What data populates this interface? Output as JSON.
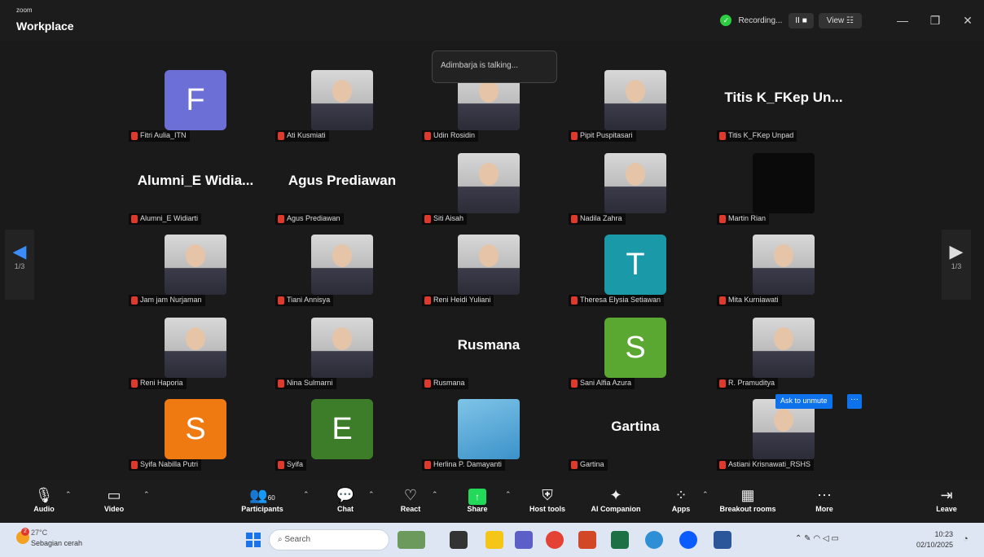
{
  "titlebar": {
    "brand_small": "zoom",
    "brand": "Workplace",
    "recording": "Recording...",
    "pause_stop": "II ■",
    "view": "View ☷",
    "minimize": "—",
    "restore": "❐",
    "close": "✕"
  },
  "talking_notice": "Adimbarja is talking...",
  "page_indicator": "1/3",
  "page_indicator_right": "1/3",
  "participants": [
    {
      "label": "Fitri Aulia_ITN",
      "avatar_letter": "F",
      "avatar_color": "#6b6fd6",
      "kind": "letter"
    },
    {
      "label": "Ati Kusmiati",
      "kind": "photo"
    },
    {
      "label": "Udin Rosidin",
      "kind": "photo"
    },
    {
      "label": "Pipit Puspitasari",
      "kind": "photo"
    },
    {
      "label": "Titis K_FKep Unpad",
      "display_name": "Titis K_FKep Un...",
      "kind": "name"
    },
    {
      "label": "Alumni_E Widiarti",
      "display_name": "Alumni_E Widia...",
      "kind": "name"
    },
    {
      "label": "Agus Prediawan",
      "display_name": "Agus Prediawan",
      "kind": "name"
    },
    {
      "label": "Siti Aisah",
      "kind": "photo"
    },
    {
      "label": "Nadila Zahra",
      "kind": "photo"
    },
    {
      "label": "Martin Rian",
      "kind": "dark"
    },
    {
      "label": "Jam jam Nurjaman",
      "kind": "photo"
    },
    {
      "label": "Tiani Annisya",
      "kind": "photo"
    },
    {
      "label": "Reni Heidi Yuliani",
      "kind": "photo"
    },
    {
      "label": "Theresa Elysia Setiawan",
      "avatar_letter": "T",
      "avatar_color": "#1a9aa8",
      "kind": "letter"
    },
    {
      "label": "Mita Kurniawati",
      "kind": "photo"
    },
    {
      "label": "Reni Haporia",
      "kind": "photo"
    },
    {
      "label": "Nina Sulmarni",
      "kind": "photo"
    },
    {
      "label": "Rusmana",
      "display_name": "Rusmana",
      "kind": "name"
    },
    {
      "label": "Sani Alfia Azura",
      "avatar_letter": "S",
      "avatar_color": "#5aa832",
      "kind": "letter"
    },
    {
      "label": "R. Pramuditya",
      "kind": "photo"
    },
    {
      "label": "Syifa Nabilla Putri",
      "avatar_letter": "S",
      "avatar_color": "#f07a12",
      "kind": "letter"
    },
    {
      "label": "Syifa",
      "avatar_letter": "E",
      "avatar_color": "#3d7d2a",
      "kind": "letter"
    },
    {
      "label": "Herlina P. Damayanti",
      "kind": "flower"
    },
    {
      "label": "Gartina",
      "display_name": "Gartina",
      "kind": "name"
    },
    {
      "label": "Astiani Krisnawati_RSHS",
      "kind": "photo"
    }
  ],
  "ask_unmute": "Ask to unmute",
  "ask_more": "···",
  "toolbar": {
    "audio": "Audio",
    "video": "Video",
    "participants": "Participants",
    "participants_count": "60",
    "chat": "Chat",
    "react": "React",
    "share": "Share",
    "host_tools": "Host tools",
    "ai_companion": "AI Companion",
    "apps": "Apps",
    "breakout": "Breakout rooms",
    "more": "More",
    "leave": "Leave"
  },
  "taskbar": {
    "weather_temp": "27°C",
    "weather_desc": "Sebagian cerah",
    "weather_badge": "2",
    "search": "Search",
    "time": "10:23",
    "date": "02/10/2025"
  }
}
